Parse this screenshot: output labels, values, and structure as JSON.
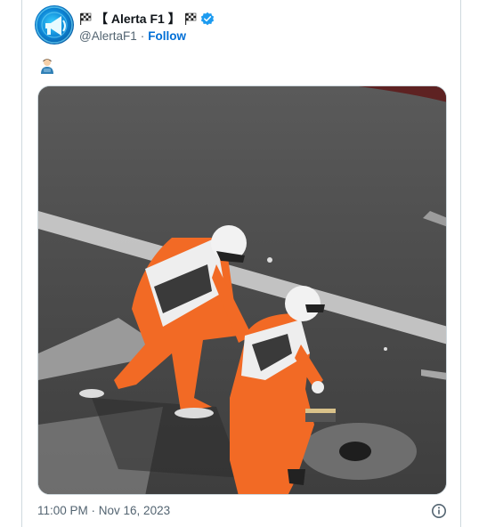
{
  "author": {
    "display_name": "【 Alerta F1 】",
    "handle": "@AlertaF1",
    "separator": "·",
    "follow_label": "Follow"
  },
  "post": {
    "emoji_icon": "person-emoji-icon",
    "media_description_icon": "photo",
    "timestamp": "11:00 PM · Nov 16, 2023"
  },
  "colors": {
    "verified": "#1d9bf0",
    "follow": "#006fd6",
    "marshal_orange": "#f26a25"
  }
}
